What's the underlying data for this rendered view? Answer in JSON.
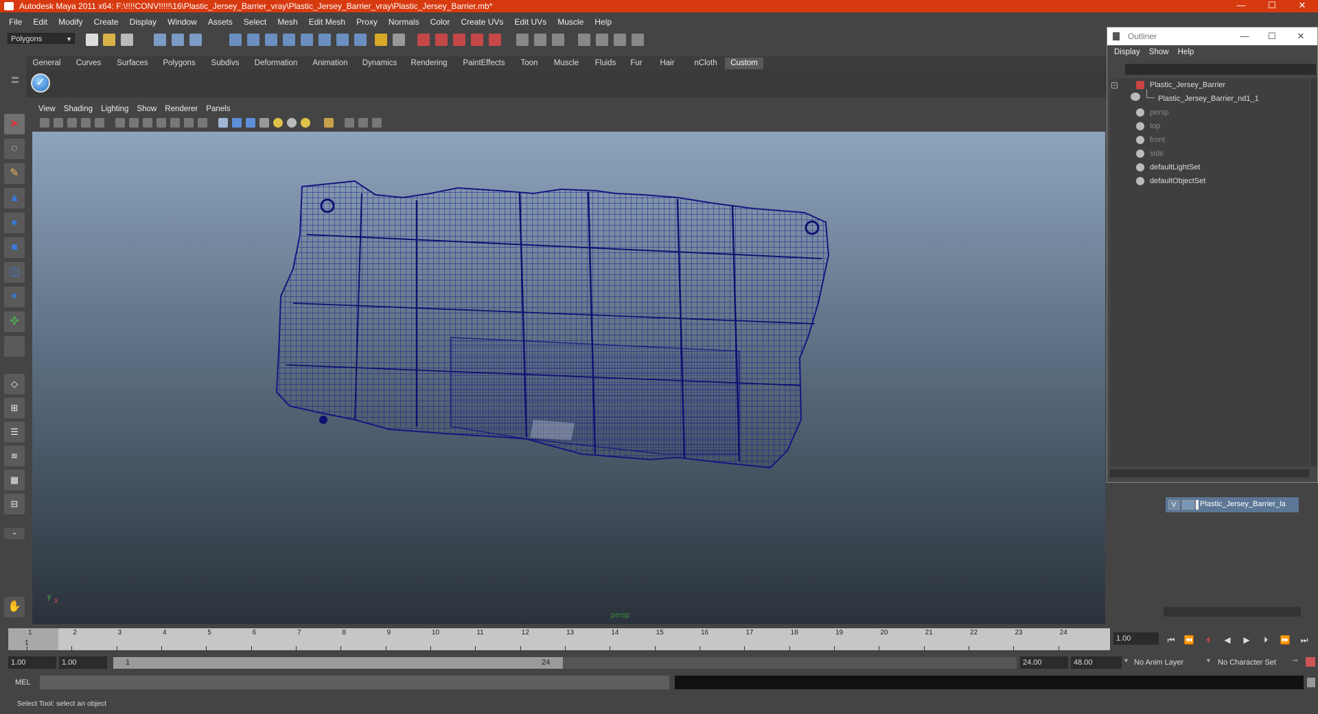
{
  "window": {
    "title": "Autodesk Maya 2011 x64: F:\\!!!!CONV!!!!!\\16\\Plastic_Jersey_Barrier_vray\\Plastic_Jersey_Barrier_vray\\Plastic_Jersey_Barrier.mb*",
    "minimize": "—",
    "maximize": "☐",
    "close": "✕"
  },
  "menubar": [
    "File",
    "Edit",
    "Modify",
    "Create",
    "Display",
    "Window",
    "Assets",
    "Select",
    "Mesh",
    "Edit Mesh",
    "Proxy",
    "Normals",
    "Color",
    "Create UVs",
    "Edit UVs",
    "Muscle",
    "Help"
  ],
  "statusline": {
    "mode": "Polygons"
  },
  "shelf": {
    "tabs": [
      "General",
      "Curves",
      "Surfaces",
      "Polygons",
      "Subdivs",
      "Deformation",
      "Animation",
      "Dynamics",
      "Rendering",
      "PaintEffects",
      "Toon",
      "Muscle",
      "Fluids",
      "Fur",
      "Hair",
      "nCloth",
      "Custom"
    ],
    "active_tab": "Custom"
  },
  "viewport": {
    "menu": [
      "View",
      "Shading",
      "Lighting",
      "Show",
      "Renderer",
      "Panels"
    ],
    "camera_label": "persp",
    "axis_y": "y",
    "axis_x": "x",
    "wire_color": "#1a1a8c"
  },
  "outliner": {
    "title": "Outliner",
    "menu": [
      "Display",
      "Show",
      "Help"
    ],
    "items": [
      {
        "label": "Plastic_Jersey_Barrier",
        "dim": false
      },
      {
        "label": "Plastic_Jersey_Barrier_nd1_1",
        "dim": false
      },
      {
        "label": "persp",
        "dim": true
      },
      {
        "label": "top",
        "dim": true
      },
      {
        "label": "front",
        "dim": true
      },
      {
        "label": "side",
        "dim": true
      },
      {
        "label": "defaultLightSet",
        "dim": false
      },
      {
        "label": "defaultObjectSet",
        "dim": false
      }
    ]
  },
  "layers": {
    "visible_flag": "V",
    "layer_name": "Plastic_Jersey_Barrier_la"
  },
  "timeslider": {
    "ticks": [
      "1",
      "2",
      "3",
      "4",
      "5",
      "6",
      "7",
      "8",
      "9",
      "10",
      "11",
      "12",
      "13",
      "14",
      "15",
      "16",
      "17",
      "18",
      "19",
      "20",
      "21",
      "22",
      "23",
      "24"
    ],
    "current_frame": "1",
    "current_time_field": "1.00"
  },
  "range": {
    "start_time": "1.00",
    "playback_start": "1.00",
    "range_start_label": "1",
    "range_end_label": "24",
    "playback_end": "24.00",
    "end_time": "48.00",
    "anim_layer": "No Anim Layer",
    "character_set": "No Character Set"
  },
  "command": {
    "label": "MEL"
  },
  "help": {
    "text": "Select Tool: select an object"
  }
}
